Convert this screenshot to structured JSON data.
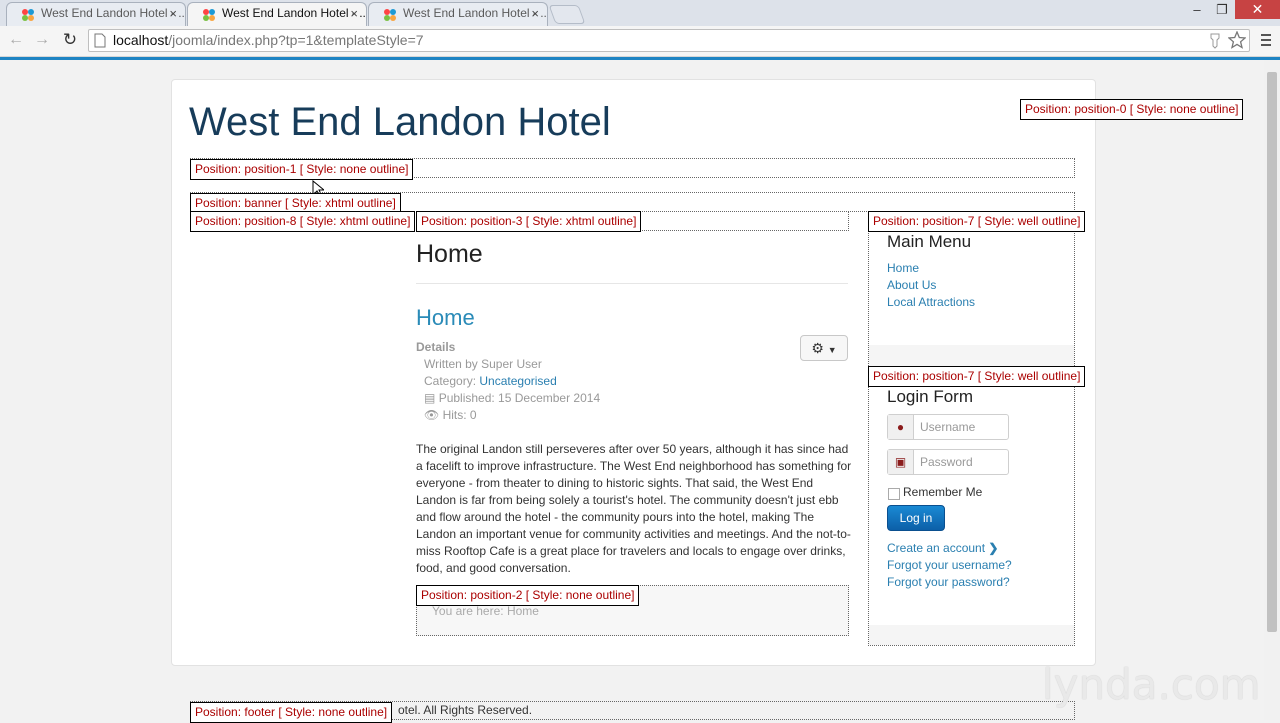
{
  "browser": {
    "tabs": [
      {
        "title": "West End Landon Hotel - ...",
        "active": false
      },
      {
        "title": "West End Landon Hotel - ...",
        "active": true
      },
      {
        "title": "West End Landon Hotel - ...",
        "active": false
      }
    ],
    "tab_close": "×",
    "url_host": "localhost",
    "url_path": "/joomla/index.php?tp=1&templateStyle=7",
    "window_minimize": "–",
    "window_restore": "❐",
    "window_close": "✕"
  },
  "site": {
    "title": "West End Landon Hotel"
  },
  "positions": {
    "position0": "Position: position-0 [ Style: none outline]",
    "position1": "Position: position-1 [ Style: none outline]",
    "banner": "Position: banner [ Style: xhtml outline]",
    "position8": "Position: position-8 [ Style: xhtml outline]",
    "position3": "Position: position-3 [ Style: xhtml outline]",
    "position7a": "Position: position-7 [ Style: well outline]",
    "position7b": "Position: position-7 [ Style: well outline]",
    "position2": "Position: position-2 [ Style: none outline]",
    "footer": "Position: footer [ Style: none outline]"
  },
  "main": {
    "page_heading": "Home",
    "article_title": "Home",
    "details_label": "Details",
    "written_by": "Written by Super User",
    "category_label": "Category:",
    "category_link": "Uncategorised",
    "published": "Published: 15 December 2014",
    "hits": "Hits: 0",
    "body": "The original Landon still perseveres after over 50 years, although it has since had a facelift to improve infrastructure. The West End neighborhood has something for everyone - from theater to dining to historic sights. That said, the West End Landon is far from being solely a tourist's hotel. The community doesn't just ebb and flow around the hotel - the community pours into the hotel, making The Landon an important venue for community activities and meetings. And the not-to-miss Rooftop Cafe is a great place for travelers and locals to engage over drinks, food, and good conversation.",
    "breadcrumb": "You are here:  Home"
  },
  "main_menu": {
    "title": "Main Menu",
    "items": [
      "Home",
      "About Us",
      "Local Attractions"
    ]
  },
  "login": {
    "title": "Login Form",
    "username_placeholder": "Username",
    "password_placeholder": "Password",
    "remember_label": "Remember Me",
    "login_button": "Log in",
    "create_account": "Create an account",
    "forgot_username": "Forgot your username?",
    "forgot_password": "Forgot your password?"
  },
  "footer": {
    "copyright_fragment": "otel. All Rights Reserved."
  },
  "watermark": "lynda.com"
}
